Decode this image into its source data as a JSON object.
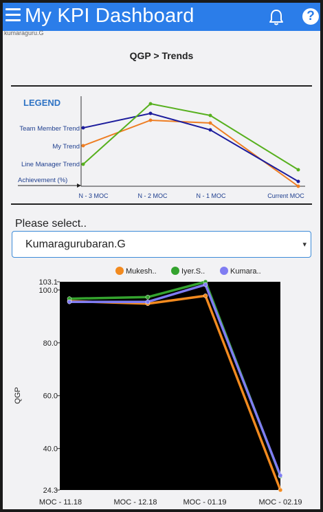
{
  "app": {
    "title": "My KPI Dashboard",
    "subtext": "kumaraguru.G"
  },
  "page": {
    "title": "QGP > Trends"
  },
  "legend_graphic": {
    "heading": "LEGEND",
    "labels": [
      "Team Member Trend",
      "My Trend",
      "Line Manager Trend",
      "Achievement (%)"
    ],
    "x_labels": [
      "N - 3 MOC",
      "N - 2  MOC",
      "N - 1  MOC",
      "Current MOC"
    ],
    "colors": {
      "team_member": "#1c1c9c",
      "my": "#ee7d22",
      "line_manager": "#57b01e"
    }
  },
  "selector": {
    "label": "Please select..",
    "value": "Kumaragurubaran.G",
    "caret": "▾"
  },
  "chart_data": {
    "type": "line",
    "categories": [
      "MOC - 11.18",
      "MOC - 12.18",
      "MOC - 01.19",
      "MOC - 02.19"
    ],
    "series": [
      {
        "name": "Mukesh..",
        "color": "#f28a1f",
        "values": [
          95.8,
          94.8,
          97.8,
          24.3
        ]
      },
      {
        "name": "Iyer.S..",
        "color": "#34a32e",
        "values": [
          96.7,
          97.3,
          103.1,
          29.5
        ]
      },
      {
        "name": "Kumara..",
        "color": "#7f7cf2",
        "values": [
          95.5,
          95.5,
          102.0,
          29.8
        ]
      }
    ],
    "ylabel": "QGP",
    "ylim": [
      24.3,
      103.1
    ],
    "yticks": [
      "103.1",
      "100.0",
      "80.0",
      "60.0",
      "40.0",
      "24.3"
    ],
    "ytick_values": [
      103.1,
      100.0,
      80.0,
      60.0,
      40.0,
      24.3
    ],
    "background": "#000000",
    "legend_position": "top"
  }
}
